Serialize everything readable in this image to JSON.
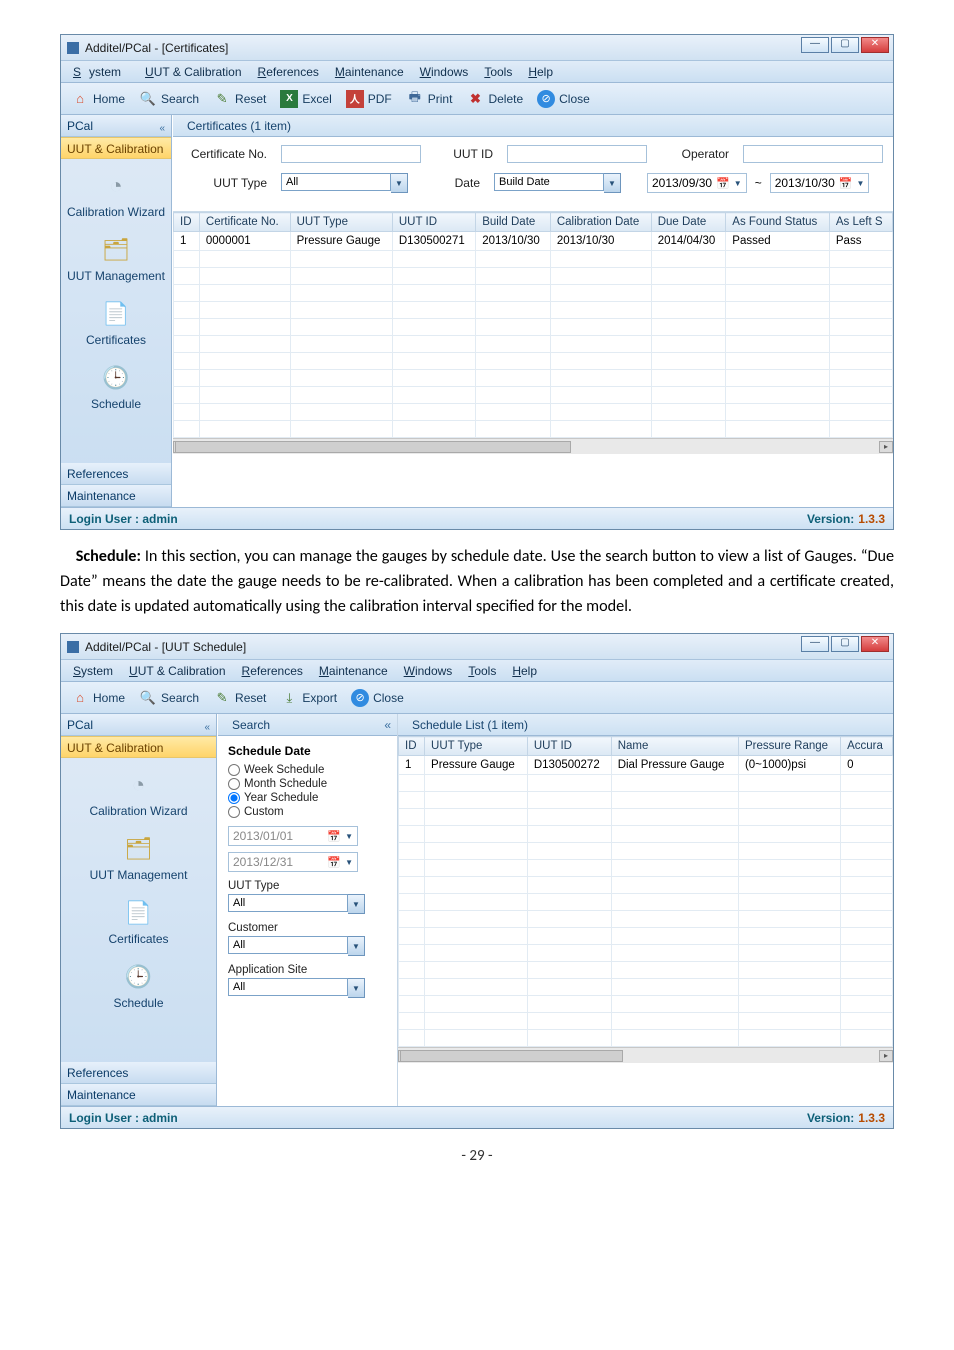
{
  "win1": {
    "title": "Additel/PCal - [Certificates]",
    "menus": [
      "System",
      "UUT & Calibration",
      "References",
      "Maintenance",
      "Windows",
      "Tools",
      "Help"
    ],
    "toolbar": {
      "home": "Home",
      "search": "Search",
      "reset": "Reset",
      "excel": "Excel",
      "pdf": "PDF",
      "print": "Print",
      "delete": "Delete",
      "close": "Close"
    },
    "left": {
      "header": "PCal",
      "sections": {
        "uut": "UUT & Calibration",
        "refs": "References",
        "maint": "Maintenance"
      },
      "items": {
        "wizard": "Calibration Wizard",
        "uutmgmt": "UUT Management",
        "certs": "Certificates",
        "sched": "Schedule"
      }
    },
    "tab": "Certificates   (1 item)",
    "search": {
      "certno_label": "Certificate No.",
      "certno_val": "",
      "uutid_label": "UUT ID",
      "uutid_val": "",
      "operator_label": "Operator",
      "operator_val": "",
      "uuttype_label": "UUT Type",
      "uuttype_val": "All",
      "date_label": "Date",
      "date_combo": "Build Date",
      "date_from": "2013/09/30",
      "date_sep": "~",
      "date_to": "2013/10/30"
    },
    "grid": {
      "cols": [
        "ID",
        "Certificate No.",
        "UUT Type",
        "UUT ID",
        "Build Date",
        "Calibration Date",
        "Due Date",
        "As Found Status",
        "As Left S"
      ],
      "row": [
        "1",
        "0000001",
        "Pressure Gauge",
        "D130500271",
        "2013/10/30",
        "2013/10/30",
        "2014/04/30",
        "Passed",
        "Pass"
      ]
    },
    "footer": {
      "user": "Login User :  admin",
      "vlabel": "Version:",
      "vval": "1.3.3"
    }
  },
  "bodytext": "Schedule: In this section, you can manage the gauges by schedule date. Use the search button to view a list of Gauges. “Due Date” means the date the gauge needs to be re-calibrated. When a calibration has been completed and a certificate created, this date is updated automatically using the calibration interval specified for the model.",
  "win2": {
    "title": "Additel/PCal - [UUT Schedule]",
    "menus": [
      "System",
      "UUT & Calibration",
      "References",
      "Maintenance",
      "Windows",
      "Tools",
      "Help"
    ],
    "toolbar": {
      "home": "Home",
      "search": "Search",
      "reset": "Reset",
      "export": "Export",
      "close": "Close"
    },
    "left": {
      "header": "PCal",
      "sections": {
        "uut": "UUT & Calibration",
        "refs": "References",
        "maint": "Maintenance"
      },
      "items": {
        "wizard": "Calibration Wizard",
        "uutmgmt": "UUT Management",
        "certs": "Certificates",
        "sched": "Schedule"
      }
    },
    "searchpanel": {
      "tab": "Search",
      "group": "Schedule Date",
      "opts": {
        "week": "Week Schedule",
        "month": "Month Schedule",
        "year": "Year Schedule",
        "custom": "Custom"
      },
      "date_from": "2013/01/01",
      "date_to": "2013/12/31",
      "uuttype_label": "UUT Type",
      "uuttype_val": "All",
      "customer_label": "Customer",
      "customer_val": "All",
      "appsite_label": "Application Site",
      "appsite_val": "All"
    },
    "listtab": "Schedule List   (1 item)",
    "grid": {
      "cols": [
        "ID",
        "UUT Type",
        "UUT ID",
        "Name",
        "Pressure Range",
        "Accura"
      ],
      "row": [
        "1",
        "Pressure Gauge",
        "D130500272",
        "Dial Pressure Gauge",
        "(0~1000)psi",
        "0"
      ]
    },
    "footer": {
      "user": "Login User :  admin",
      "vlabel": "Version:",
      "vval": "1.3.3"
    }
  },
  "pagefoot": "- 29 -"
}
